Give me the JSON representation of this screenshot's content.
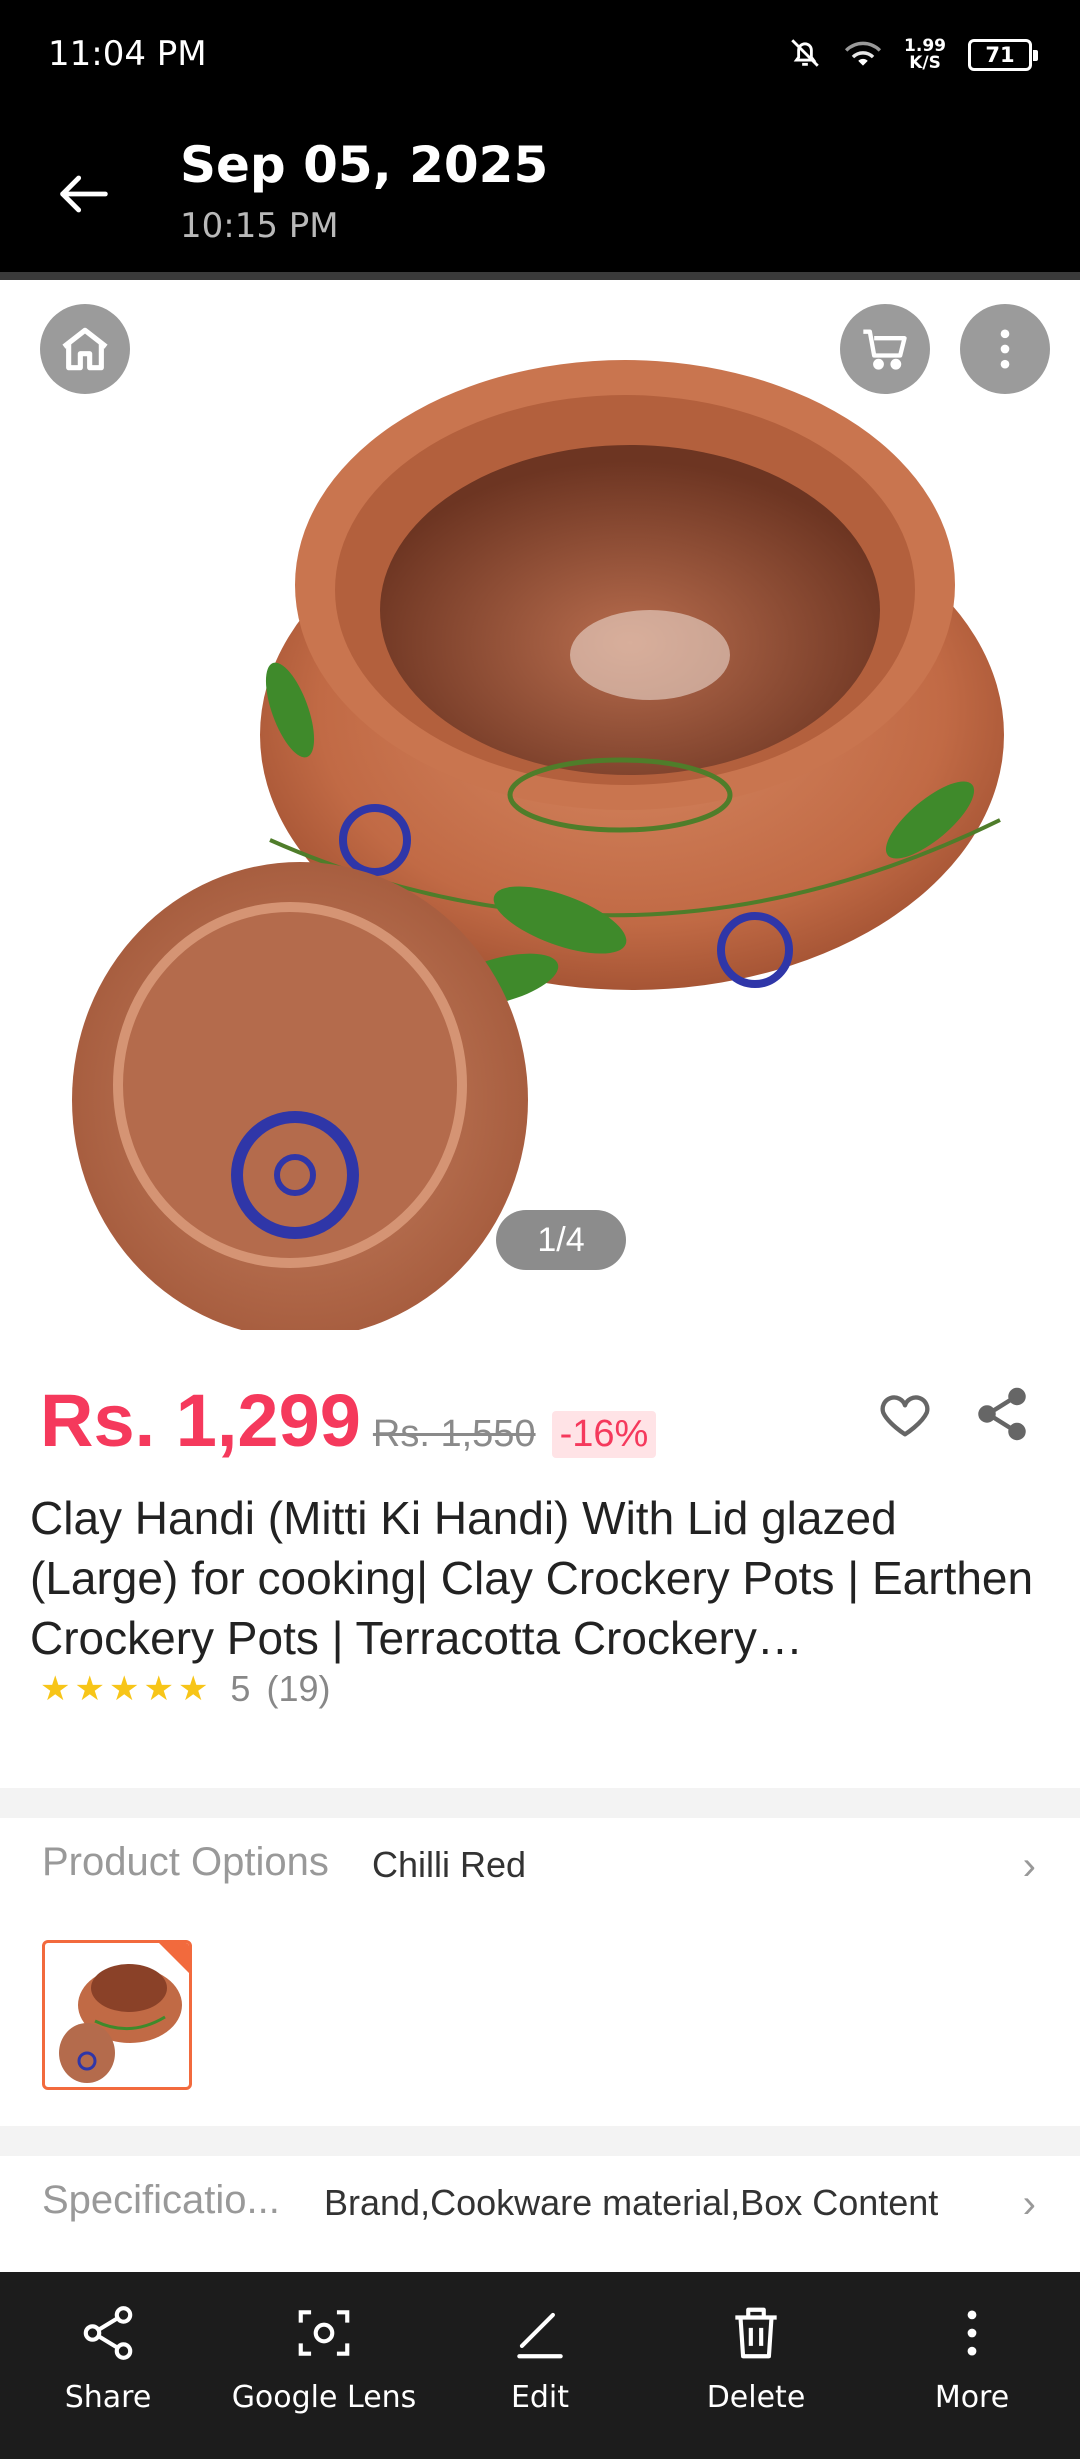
{
  "status_bar": {
    "time": "11:04 PM",
    "net_speed_value": "1.99",
    "net_speed_unit": "K/S",
    "battery": "71"
  },
  "header": {
    "date": "Sep 05, 2025",
    "time": "10:15 PM"
  },
  "product": {
    "image_counter": "1/4",
    "price": "Rs. 1,299",
    "old_price": "Rs. 1,550",
    "discount": "-16%",
    "title": "Clay Handi (Mitti Ki Handi) With Lid glazed (Large) for cooking| Clay Crockery Pots | Earthen Crockery Pots | Terracotta Crockery…",
    "rating_value": "5",
    "rating_count": "(19)",
    "stars": 5
  },
  "options": {
    "label": "Product Options",
    "value": "Chilli Red"
  },
  "specifications": {
    "label": "Specificatio...",
    "value": "Brand,Cookware material,Box Content"
  },
  "actions": {
    "share": "Share",
    "lens": "Google Lens",
    "edit": "Edit",
    "delete": "Delete",
    "more": "More"
  },
  "colors": {
    "price": "#f5395c",
    "accent": "#f26a3d",
    "star": "#f7c518",
    "bar": "#1c1c1c"
  }
}
